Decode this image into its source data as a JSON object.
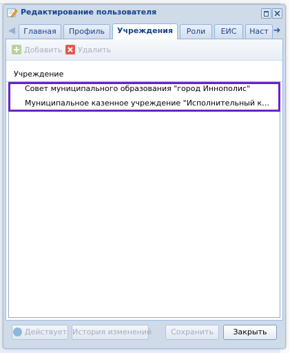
{
  "window": {
    "title": "Редактирование пользователя"
  },
  "tabs": [
    {
      "label": "Главная",
      "active": false
    },
    {
      "label": "Профиль",
      "active": false
    },
    {
      "label": "Учреждения",
      "active": true
    },
    {
      "label": "Роли",
      "active": false
    },
    {
      "label": "ЕИС",
      "active": false
    },
    {
      "label": "Наст",
      "active": false
    }
  ],
  "toolbar": {
    "add_label": "Добавить",
    "delete_label": "Удалить"
  },
  "grid": {
    "column_header": "Учреждение",
    "rows": [
      "Совет муниципального образования \"город Иннополис\"",
      "Муниципальное казенное учреждение \"Исполнительный комитет го..."
    ]
  },
  "footer": {
    "active_label": "Действует",
    "history_label": "История изменений",
    "save_label": "Сохранить",
    "close_label": "Закрыть"
  },
  "colors": {
    "highlight": "#6a22c8",
    "title": "#15428b"
  }
}
